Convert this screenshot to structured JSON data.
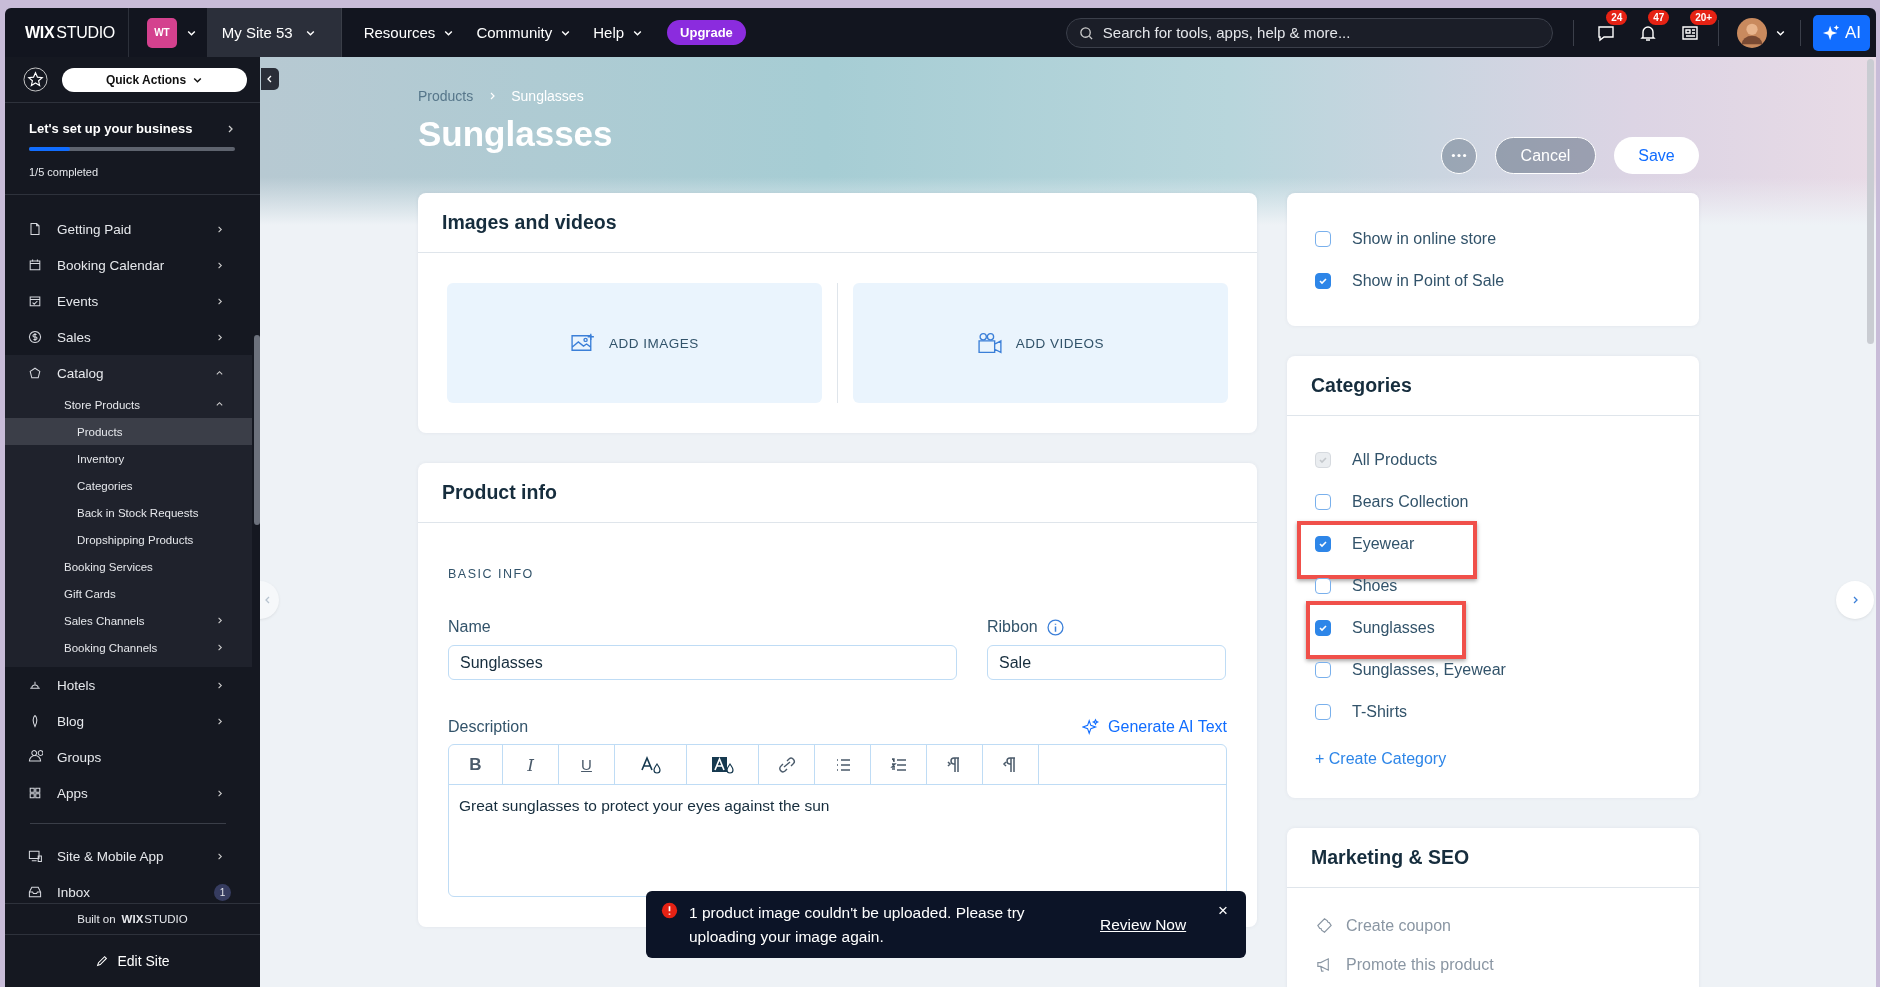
{
  "topbar": {
    "logo": {
      "bold": "WIX",
      "light": "STUDIO"
    },
    "workspace_badge": "WT",
    "site": "My Site 53",
    "menus": [
      "Resources",
      "Community",
      "Help"
    ],
    "upgrade": "Upgrade",
    "search": {
      "placeholder": "Search for tools, apps, help & more..."
    },
    "notifications": [
      {
        "kind": "chat",
        "count": "24"
      },
      {
        "kind": "bell",
        "count": "47"
      },
      {
        "kind": "news",
        "count": "20+"
      }
    ],
    "ai_button": "AI"
  },
  "sidebar": {
    "quick_actions": "Quick Actions",
    "setup": {
      "title": "Let's set up your business",
      "level": 0.2,
      "progress": "1/5 completed"
    },
    "sections": [
      [
        {
          "label": "Getting Paid",
          "expandable": true,
          "expanded": false
        },
        {
          "label": "Booking Calendar",
          "expandable": true,
          "expanded": false
        },
        {
          "label": "Events",
          "expandable": true,
          "expanded": false
        },
        {
          "label": "Sales",
          "expandable": true,
          "expanded": false
        },
        {
          "label": "Catalog",
          "expandable": true,
          "expanded": true,
          "children": [
            {
              "label": "Store Products",
              "expandable": true,
              "expanded": true,
              "selected": false,
              "children": [
                {
                  "label": "Products",
                  "selected": true
                },
                {
                  "label": "Inventory",
                  "selected": false
                },
                {
                  "label": "Categories",
                  "selected": false
                },
                {
                  "label": "Back in Stock Requests",
                  "selected": false
                },
                {
                  "label": "Dropshipping Products",
                  "selected": false
                }
              ]
            },
            {
              "label": "Booking Services",
              "expandable": false,
              "expanded": false,
              "selected": false
            },
            {
              "label": "Gift Cards",
              "expandable": false,
              "expanded": false,
              "selected": false
            },
            {
              "label": "Sales Channels",
              "expandable": true,
              "expanded": false,
              "selected": false
            },
            {
              "label": "Booking Channels",
              "expandable": true,
              "expanded": false,
              "selected": false
            }
          ]
        },
        {
          "label": "Hotels",
          "expandable": true,
          "expanded": false
        },
        {
          "label": "Blog",
          "expandable": true,
          "expanded": false
        },
        {
          "label": "Groups",
          "expandable": false
        },
        {
          "label": "Apps",
          "expandable": true,
          "expanded": false
        }
      ],
      [
        {
          "label": "Site & Mobile App",
          "expandable": true,
          "expanded": false
        },
        {
          "label": "Inbox",
          "expandable": false,
          "badge": "1"
        }
      ]
    ],
    "built_on": {
      "text": "Built on",
      "logo": {
        "bold": "WIX",
        "light": "STUDIO"
      }
    },
    "edit_site": "Edit Site"
  },
  "page": {
    "breadcrumb": [
      "Products",
      "Sunglasses"
    ],
    "title": "Sunglasses",
    "actions": {
      "cancel": "Cancel",
      "save": "Save"
    },
    "media": {
      "title": "Images and videos",
      "uploads": [
        {
          "kind": "images",
          "label": "ADD IMAGES"
        },
        {
          "kind": "videos",
          "label": "ADD VIDEOS"
        }
      ]
    },
    "product_info": {
      "title": "Product info",
      "section": "BASIC INFO",
      "name": {
        "label": "Name",
        "value": "Sunglasses"
      },
      "ribbon": {
        "label": "Ribbon",
        "value": "Sale"
      },
      "description": {
        "label": "Description",
        "ai_action": "Generate AI Text",
        "toolbar": [
          {
            "kind": "bold",
            "label": "B"
          },
          {
            "kind": "italic",
            "label": "I"
          },
          {
            "kind": "underline",
            "label": "U"
          },
          {
            "kind": "text-color"
          },
          {
            "kind": "highlight"
          },
          {
            "kind": "link"
          },
          {
            "kind": "bullets"
          },
          {
            "kind": "numbers"
          },
          {
            "kind": "ltr"
          },
          {
            "kind": "rtl"
          }
        ],
        "value": "Great sunglasses to protect your eyes against the sun"
      }
    },
    "visibility": [
      {
        "label": "Show in online store",
        "checked": false
      },
      {
        "label": "Show in Point of Sale",
        "checked": true
      }
    ],
    "categories": {
      "title": "Categories",
      "items": [
        {
          "label": "All Products",
          "checked": true,
          "disabled": true,
          "highlighted": false
        },
        {
          "label": "Bears Collection",
          "checked": false,
          "disabled": false,
          "highlighted": false
        },
        {
          "label": "Eyewear",
          "checked": true,
          "disabled": false,
          "highlighted": true
        },
        {
          "label": "Shoes",
          "checked": false,
          "disabled": false,
          "highlighted": false
        },
        {
          "label": "Sunglasses",
          "checked": true,
          "disabled": false,
          "highlighted": true
        },
        {
          "label": "Sunglasses, Eyewear",
          "checked": false,
          "disabled": false,
          "highlighted": false
        },
        {
          "label": "T-Shirts",
          "checked": false,
          "disabled": false,
          "highlighted": false
        }
      ],
      "create": "+ Create Category"
    },
    "marketing": {
      "title": "Marketing & SEO",
      "actions": [
        {
          "kind": "coupon",
          "label": "Create coupon"
        },
        {
          "kind": "promote",
          "label": "Promote this product"
        }
      ]
    }
  },
  "toast": {
    "message": "1 product image couldn't be uploaded. Please try uploading your image again.",
    "action": "Review Now",
    "close": "×"
  }
}
